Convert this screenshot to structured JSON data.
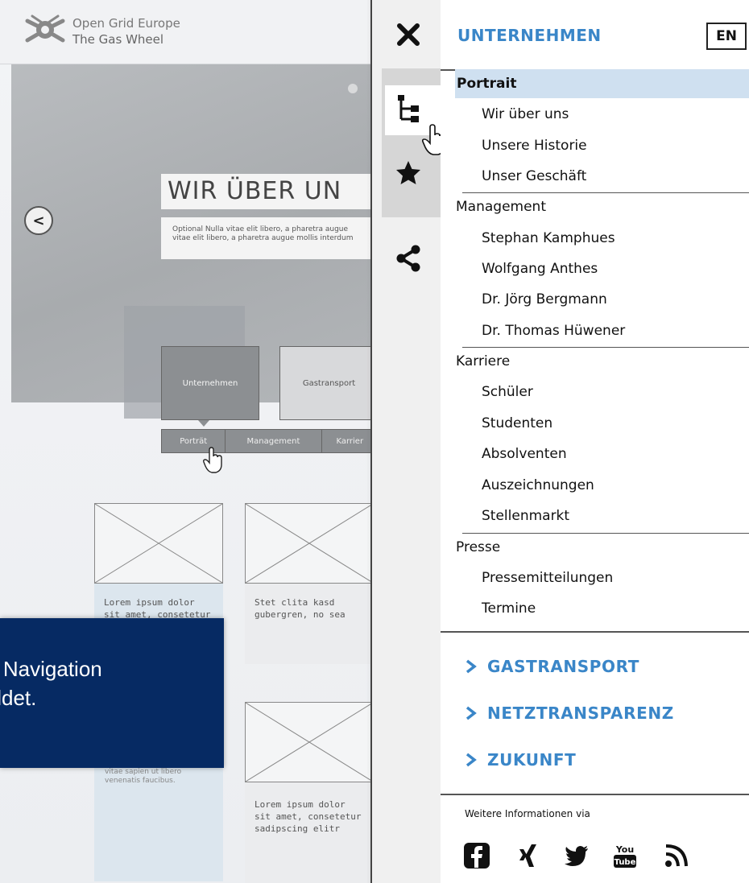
{
  "background_page": {
    "logo": {
      "line1": "Open Grid Europe",
      "line2": "The Gas Wheel"
    },
    "hero": {
      "title": "WIR ÜBER UN",
      "text_line1": "Optional Nulla vitae elit libero, a pharetra augue",
      "text_line2": "vitae elit libero, a pharetra augue mollis interdum",
      "prev_label": "<"
    },
    "tiles": [
      "Unternehmen",
      "Gastransport"
    ],
    "subnav": [
      "Porträt",
      "Management",
      "Karrier"
    ],
    "cards": [
      {
        "line1": "Lorem ipsum dolor",
        "line2": "sit amet, consetetur"
      },
      {
        "line1": "Stet clita kasd",
        "line2": "gubergren, no sea"
      },
      {
        "line1": "Lorem ipsum dolor",
        "line2": "sit amet, consetetur",
        "line3": "sadipscing elitr"
      }
    ],
    "banner": {
      "line1": "r Navigation",
      "line2": "bildet."
    },
    "ghost_text": {
      "line1": "vitae sapien ut libero",
      "line2": "venenatis faucibus."
    }
  },
  "rail": {
    "icons": [
      "close-icon",
      "sitemap-icon",
      "star-icon",
      "share-icon"
    ],
    "active_tab": "sitemap"
  },
  "menu": {
    "title": "UNTERNEHMEN",
    "lang": "EN",
    "items": [
      {
        "label": "Portrait",
        "level": 0,
        "active": true
      },
      {
        "label": "Wir über uns",
        "level": 1
      },
      {
        "label": "Unsere Historie",
        "level": 1
      },
      {
        "label": "Unser Geschäft",
        "level": 1
      },
      {
        "label": "Management",
        "level": 0
      },
      {
        "label": "Stephan Kamphues",
        "level": 1
      },
      {
        "label": "Wolfgang Anthes",
        "level": 1
      },
      {
        "label": "Dr. Jörg Bergmann",
        "level": 1
      },
      {
        "label": "Dr. Thomas Hüwener",
        "level": 1
      },
      {
        "label": "Karriere",
        "level": 0
      },
      {
        "label": "Schüler",
        "level": 1
      },
      {
        "label": "Studenten",
        "level": 1
      },
      {
        "label": "Absolventen",
        "level": 1
      },
      {
        "label": "Auszeichnungen",
        "level": 1
      },
      {
        "label": "Stellenmarkt",
        "level": 1
      },
      {
        "label": "Presse",
        "level": 0
      },
      {
        "label": "Pressemitteilungen",
        "level": 1
      },
      {
        "label": "Termine",
        "level": 1
      }
    ],
    "sections": [
      "GASTRANSPORT",
      "NETZTRANSPARENZ",
      "ZUKUNFT"
    ],
    "more_info": "Weitere Informationen via",
    "social": [
      "facebook-icon",
      "xing-icon",
      "twitter-icon",
      "youtube-icon",
      "rss-icon"
    ],
    "accent_color": "#3a86c8",
    "active_bg": "#cfe0f0"
  }
}
